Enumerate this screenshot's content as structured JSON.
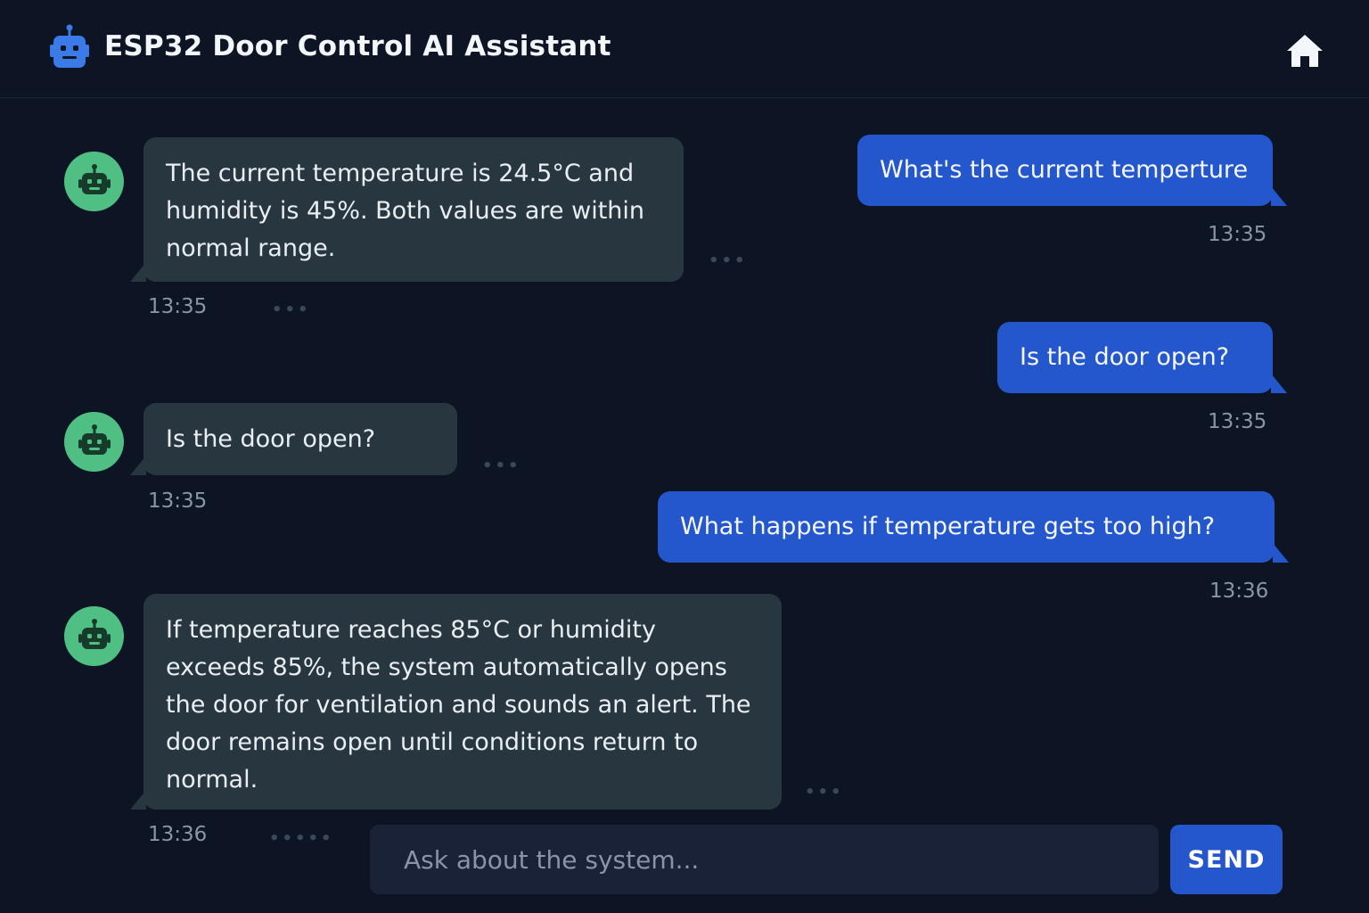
{
  "header": {
    "title": "ESP32 Door Control AI Assistant",
    "logo_icon": "robot-icon",
    "home_icon": "home-icon"
  },
  "colors": {
    "background": "#0d1424",
    "bot_bubble": "#27363f",
    "user_bubble": "#2456cc",
    "bot_avatar": "#4fbf84",
    "logo": "#3b7be8"
  },
  "messages": [
    {
      "sender": "user",
      "text": "What's the current temperture",
      "time": "13:35"
    },
    {
      "sender": "bot",
      "text": "The current temperature is 24.5°C and humidity is 45%. Both values are within normal range.",
      "time": "13:35"
    },
    {
      "sender": "user",
      "text": "Is the door open?",
      "time": "13:35"
    },
    {
      "sender": "bot",
      "text": "Is the door open?",
      "time": "13:35"
    },
    {
      "sender": "user",
      "text": "What happens if temperature gets too high?",
      "time": "13:36"
    },
    {
      "sender": "bot",
      "text": "If temperature reaches 85°C or humidity exceeds 85%, the system automatically opens the door for ventilation and sounds an alert. The door remains open until conditions return to normal.",
      "time": "13:36"
    }
  ],
  "composer": {
    "placeholder": "Ask about the system...",
    "send_label": "SEND"
  }
}
